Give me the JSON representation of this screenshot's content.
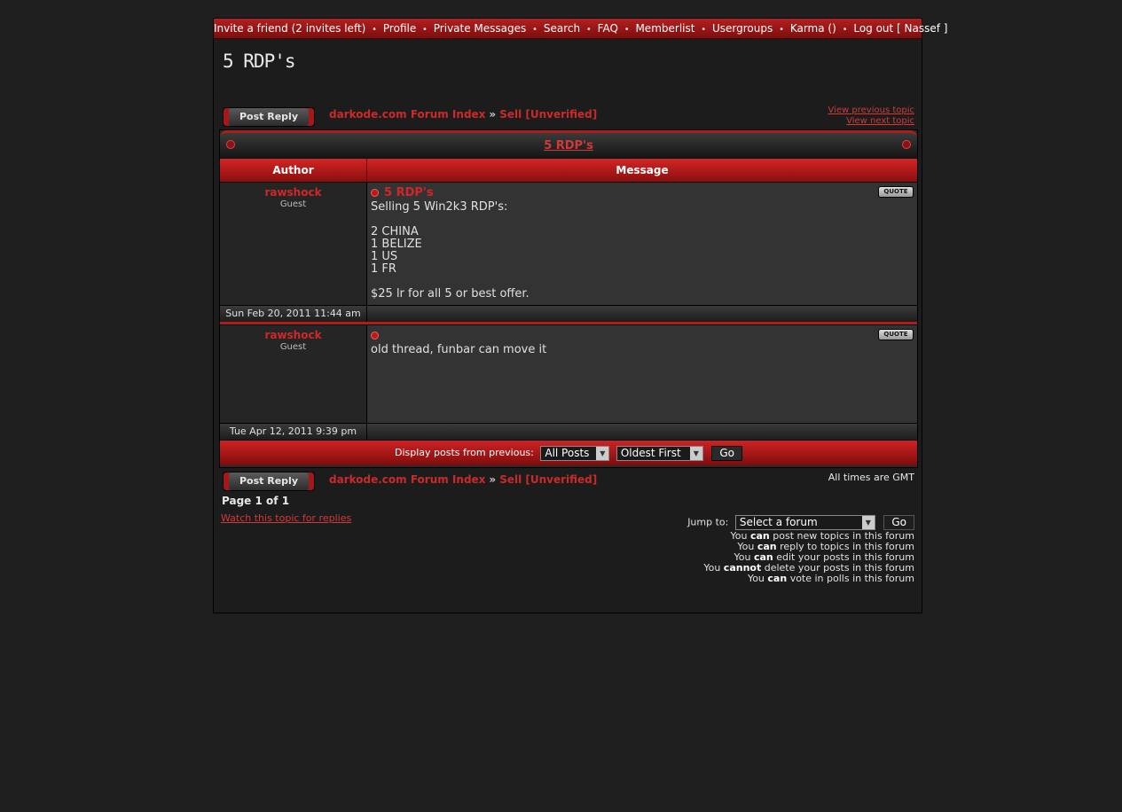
{
  "nav": [
    "Invite a friend (2 invites left)",
    "Profile",
    "Private Messages",
    "Search",
    "FAQ",
    "Memberlist",
    "Usergroups",
    "Karma ()",
    "Log out [ Nassef ]"
  ],
  "nav_sep": "•",
  "page_title": "5 RDP's",
  "post_reply_label": "Post Reply",
  "breadcrumb": {
    "forum_index": "darkode.com Forum Index",
    "sep": "»",
    "forum": "Sell [Unverified]"
  },
  "topic_nav": {
    "prev": "View previous topic",
    "next": "View next topic"
  },
  "table": {
    "topic_title": "5 RDP's",
    "col_author": "Author",
    "col_message": "Message",
    "quote_label": "QUOTE"
  },
  "posts": [
    {
      "author": "rawshock",
      "rank": "Guest",
      "subject": "5 RDP's",
      "lines": [
        "Selling 5 Win2k3 RDP's:",
        "",
        "2 CHINA",
        "1 BELIZE",
        "1 US",
        "1 FR",
        "",
        "$25 lr for all 5 or best offer."
      ],
      "date": "Sun Feb 20, 2011 11:44 am"
    },
    {
      "author": "rawshock",
      "rank": "Guest",
      "subject": "",
      "lines": [
        "old thread, funbar can move it"
      ],
      "date": "Tue Apr 12, 2011 9:39 pm"
    }
  ],
  "display_posts": {
    "label": "Display posts from previous:",
    "range_value": "All Posts",
    "order_value": "Oldest First",
    "go_label": "Go"
  },
  "timezone": "All times are GMT",
  "pagination": {
    "prefix": "Page",
    "current": "1",
    "of": "of",
    "total": "1"
  },
  "watch_topic": "Watch this topic for replies",
  "jump": {
    "label": "Jump to:",
    "value": "Select a forum",
    "go_label": "Go"
  },
  "permissions": [
    {
      "pre": "You",
      "verb": "can",
      "post": "post new topics in this forum"
    },
    {
      "pre": "You",
      "verb": "can",
      "post": "reply to topics in this forum"
    },
    {
      "pre": "You",
      "verb": "can",
      "post": "edit your posts in this forum"
    },
    {
      "pre": "You",
      "verb": "cannot",
      "post": "delete your posts in this forum"
    },
    {
      "pre": "You",
      "verb": "can",
      "post": "vote in polls in this forum"
    }
  ],
  "colors": {
    "accent": "#b81a1a",
    "link": "#d23a3a",
    "bg": "#1f1f1f"
  }
}
